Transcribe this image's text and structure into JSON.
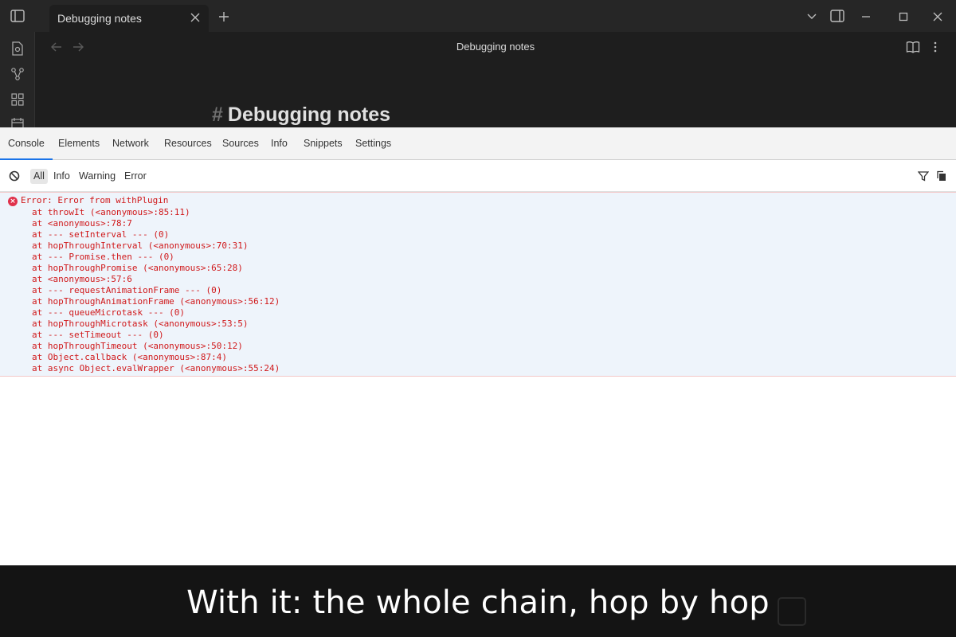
{
  "titlebar": {
    "tab_title": "Debugging notes"
  },
  "note": {
    "header_title": "Debugging notes",
    "heading_hash": "#",
    "heading": "Debugging notes"
  },
  "devtools": {
    "tabs": [
      "Console",
      "Elements",
      "Network",
      "Resources",
      "Sources",
      "Info",
      "Snippets",
      "Settings"
    ],
    "levels": [
      "All",
      "Info",
      "Warning",
      "Error"
    ],
    "error_message": "Error: Error from withPlugin",
    "frames": [
      "at throwIt (<anonymous>:85:11)",
      "at <anonymous>:78:7",
      "at --- setInterval --- (0)",
      "at hopThroughInterval (<anonymous>:70:31)",
      "at --- Promise.then --- (0)",
      "at hopThroughPromise (<anonymous>:65:28)",
      "at <anonymous>:57:6",
      "at --- requestAnimationFrame --- (0)",
      "at hopThroughAnimationFrame (<anonymous>:56:12)",
      "at --- queueMicrotask --- (0)",
      "at hopThroughMicrotask (<anonymous>:53:5)",
      "at --- setTimeout --- (0)",
      "at hopThroughTimeout (<anonymous>:50:12)",
      "at Object.callback (<anonymous>:87:4)",
      "at async Object.evalWrapper (<anonymous>:55:24)"
    ]
  },
  "caption": {
    "text": "With it: the whole chain, hop by hop"
  },
  "colors": {
    "error_red": "#d0191b",
    "error_bg": "#eef4fb",
    "active_tab_underline": "#1a73e8"
  }
}
